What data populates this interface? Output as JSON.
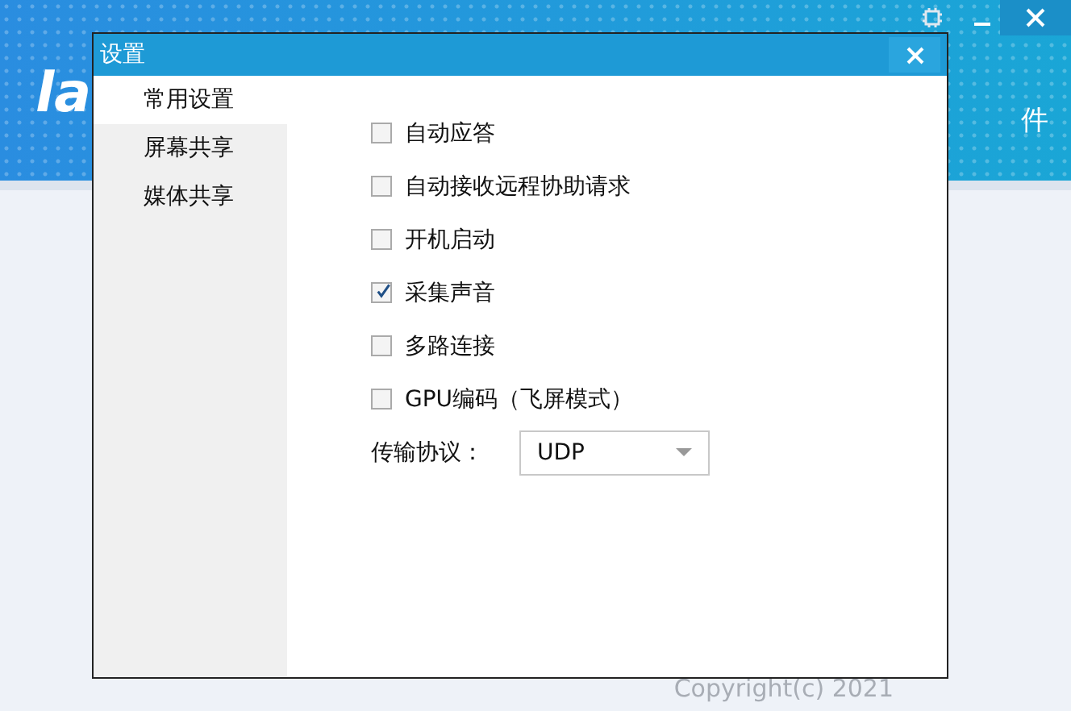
{
  "app": {
    "logo": "la",
    "menu_item": "件",
    "copyright": "Copyright(c) 2021"
  },
  "dialog": {
    "title": "设置",
    "sidebar": [
      {
        "label": "常用设置",
        "selected": true
      },
      {
        "label": "屏幕共享",
        "selected": false
      },
      {
        "label": "媒体共享",
        "selected": false
      }
    ],
    "options": [
      {
        "label": "自动应答",
        "checked": false
      },
      {
        "label": "自动接收远程协助请求",
        "checked": false
      },
      {
        "label": "开机启动",
        "checked": false
      },
      {
        "label": "采集声音",
        "checked": true
      },
      {
        "label": "多路连接",
        "checked": false
      },
      {
        "label": "GPU编码（飞屏模式）",
        "checked": false
      }
    ],
    "protocol": {
      "label": "传输协议：",
      "value": "UDP"
    }
  }
}
